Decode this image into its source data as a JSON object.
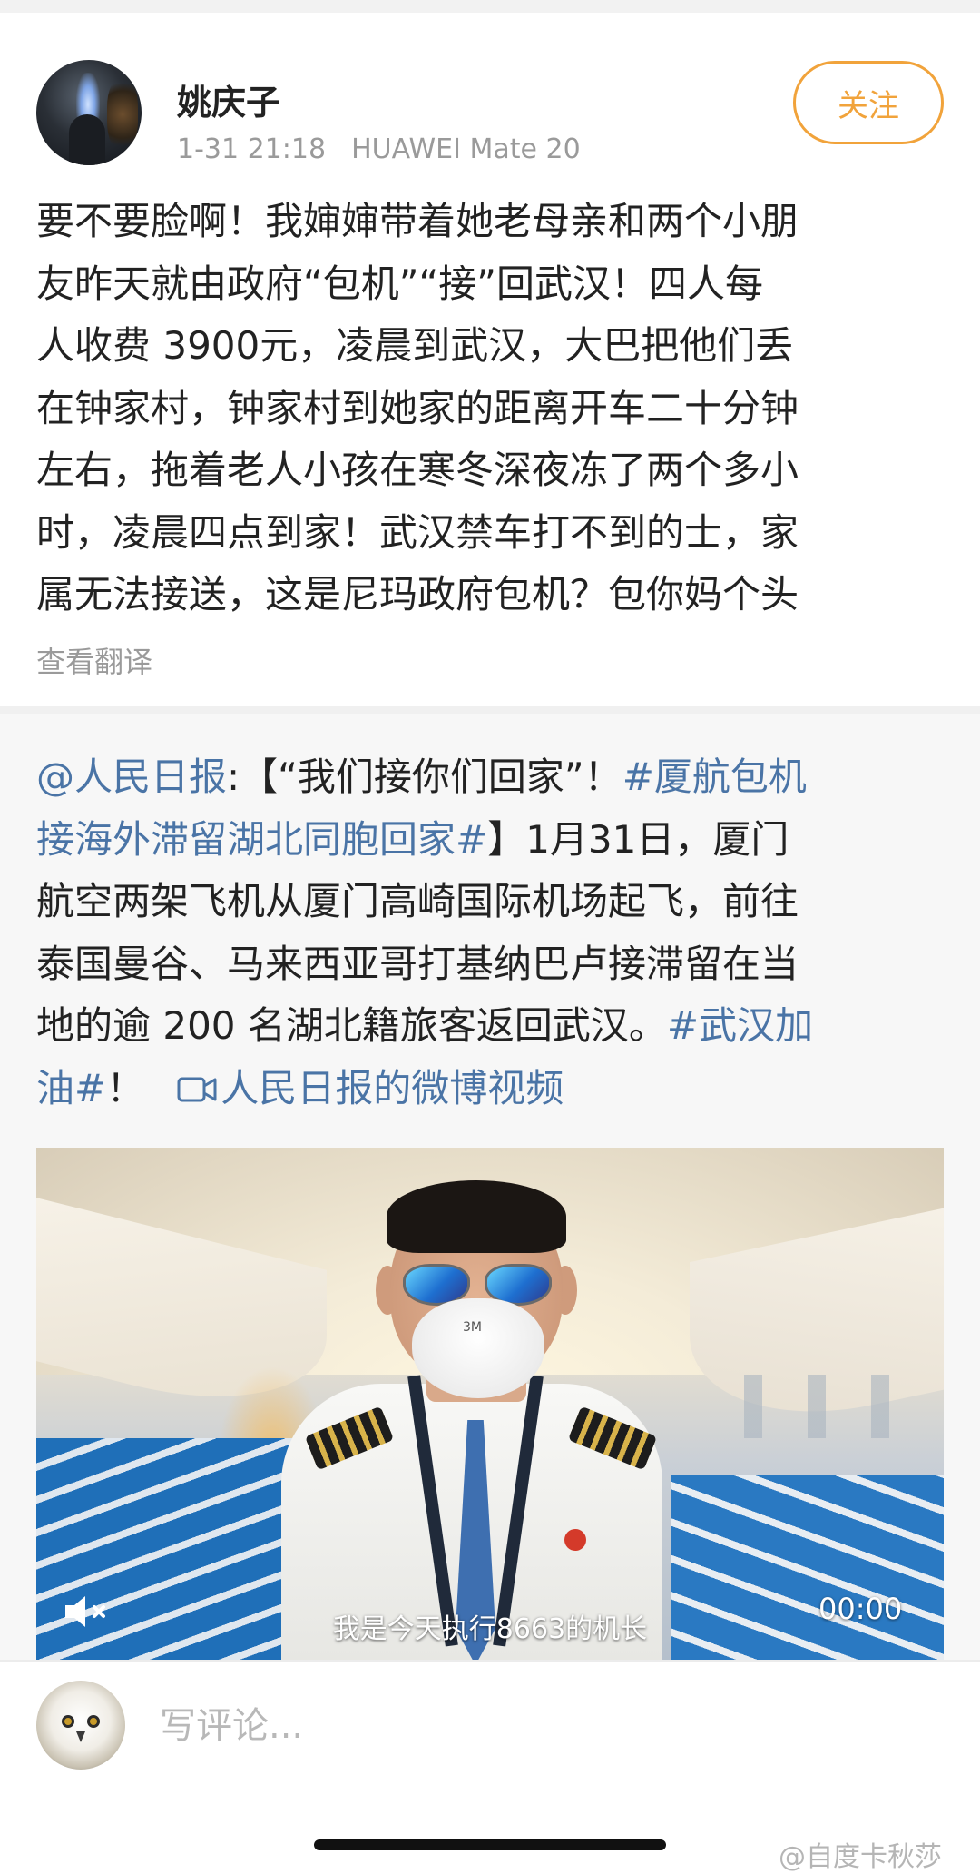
{
  "post": {
    "username": "姚庆子",
    "time": "1-31 21:18",
    "device": "HUAWEI Mate 20",
    "follow_label": "关注",
    "text_lines": [
      "要不要脸啊！我婶婶带着她老母亲和两个小朋",
      "友昨天就由政府“包机”“接”回武汉！四人每",
      "人收费 3900元，凌晨到武汉，大巴把他们丢",
      "在钟家村，钟家村到她家的距离开车二十分钟",
      "左右，拖着老人小孩在寒冬深夜冻了两个多小",
      "时，凌晨四点到家！武汉禁车打不到的士，家",
      "属无法接送，这是尼玛政府包机？包你妈个头"
    ],
    "translate_label": "查看翻译"
  },
  "repost": {
    "mention": "@人民日报",
    "colon": ":【“我们接你们回家”！",
    "hashtag1_part1": "#厦航包机",
    "hashtag1_part2": "接海外滞留湖北同胞回家#",
    "line2_rest": "】1月31日，厦门",
    "line3": "航空两架飞机从厦门高崎国际机场起飞，前往",
    "line4": "泰国曼谷、马来西亚哥打基纳巴卢接滞留在当",
    "line5_text": "地的逾 200 名湖北籍旅客返回武汉。",
    "hashtag2_part1": "#武汉加",
    "hashtag2_part2": "油#",
    "exclaim": "！",
    "video_link": "人民日报的微博视频"
  },
  "video": {
    "mask_text": "3M",
    "subtitle": "我是今天执行8663的机长",
    "duration": "00:00",
    "muted": true
  },
  "comment": {
    "placeholder": "写评论..."
  },
  "watermark": "@自度卡秋莎",
  "colors": {
    "link": "#4a74a6",
    "follow": "#f1a33b",
    "meta": "#9a9a9a"
  }
}
